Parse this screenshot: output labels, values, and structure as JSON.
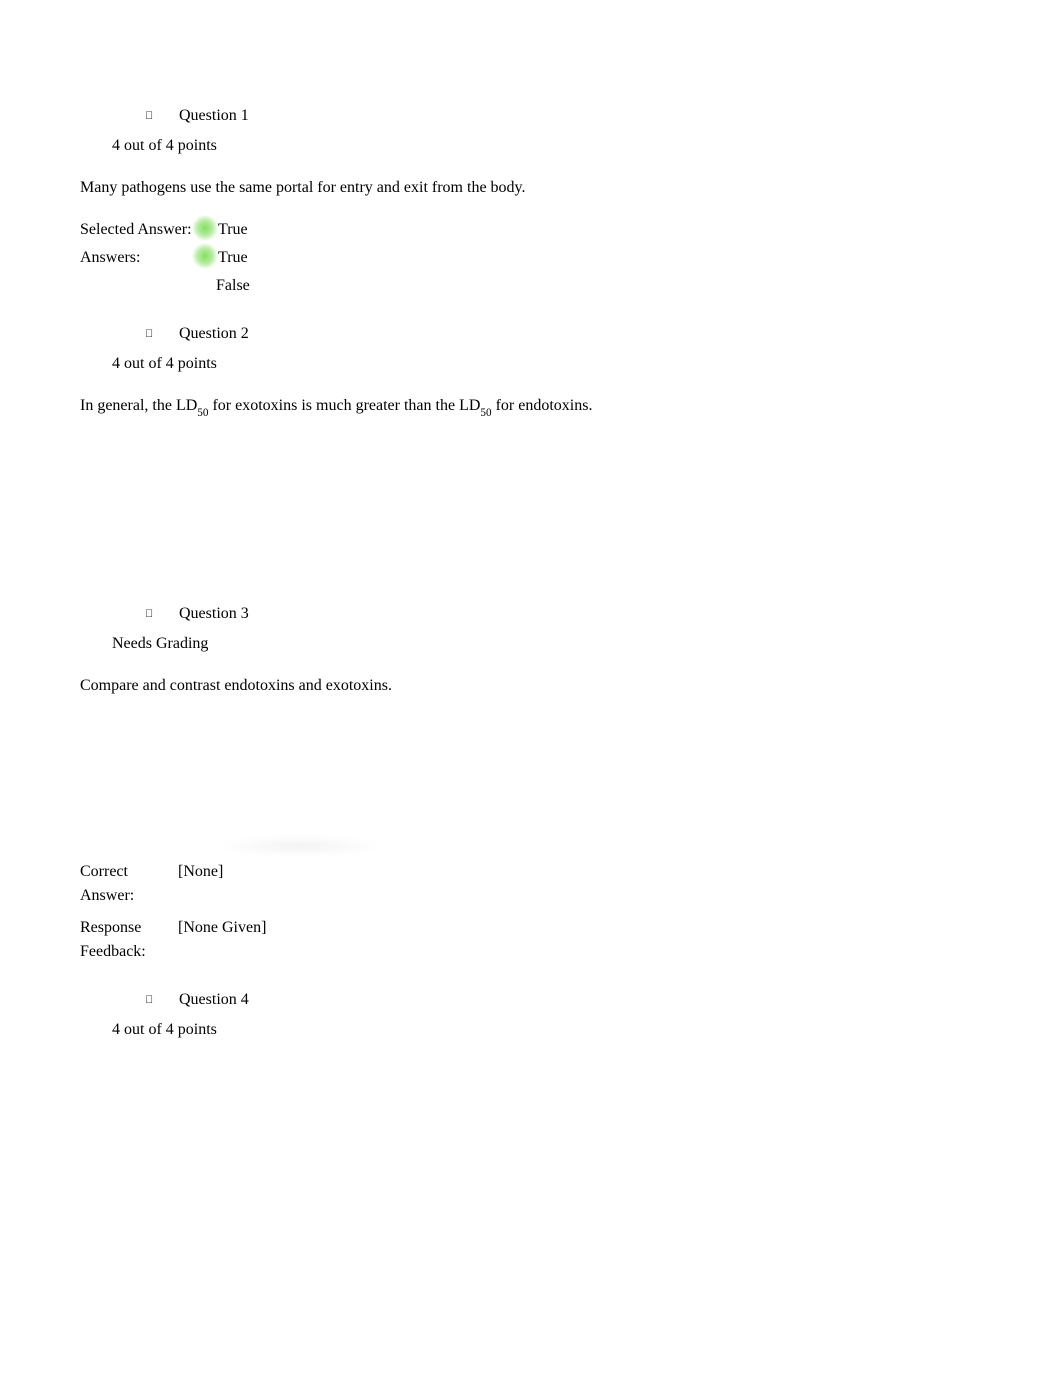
{
  "q1": {
    "label": "Question 1",
    "points": "4 out of 4 points",
    "text": "Many pathogens use the same portal for entry and exit from the body.",
    "selectedAnswerLabel": "Selected Answer:",
    "selectedAnswer": "True",
    "answersLabel": "Answers:",
    "answerTrue": "True",
    "answerFalse": "False"
  },
  "q2": {
    "label": "Question 2",
    "points": "4 out of 4 points",
    "text_pre": "In general, the LD",
    "text_sub1": "50",
    "text_mid": " for exotoxins is much greater than the LD",
    "text_sub2": "50",
    "text_post": " for endotoxins."
  },
  "q3": {
    "label": "Question 3",
    "points": "Needs Grading",
    "text": "Compare and contrast endotoxins and exotoxins.",
    "correctLabel1": "Correct",
    "correctLabel2": "Answer:",
    "correctValue": "[None]",
    "feedbackLabel1": "Response",
    "feedbackLabel2": "Feedback:",
    "feedbackValue": "[None Given]"
  },
  "q4": {
    "label": "Question 4",
    "points": "4 out of 4 points"
  }
}
